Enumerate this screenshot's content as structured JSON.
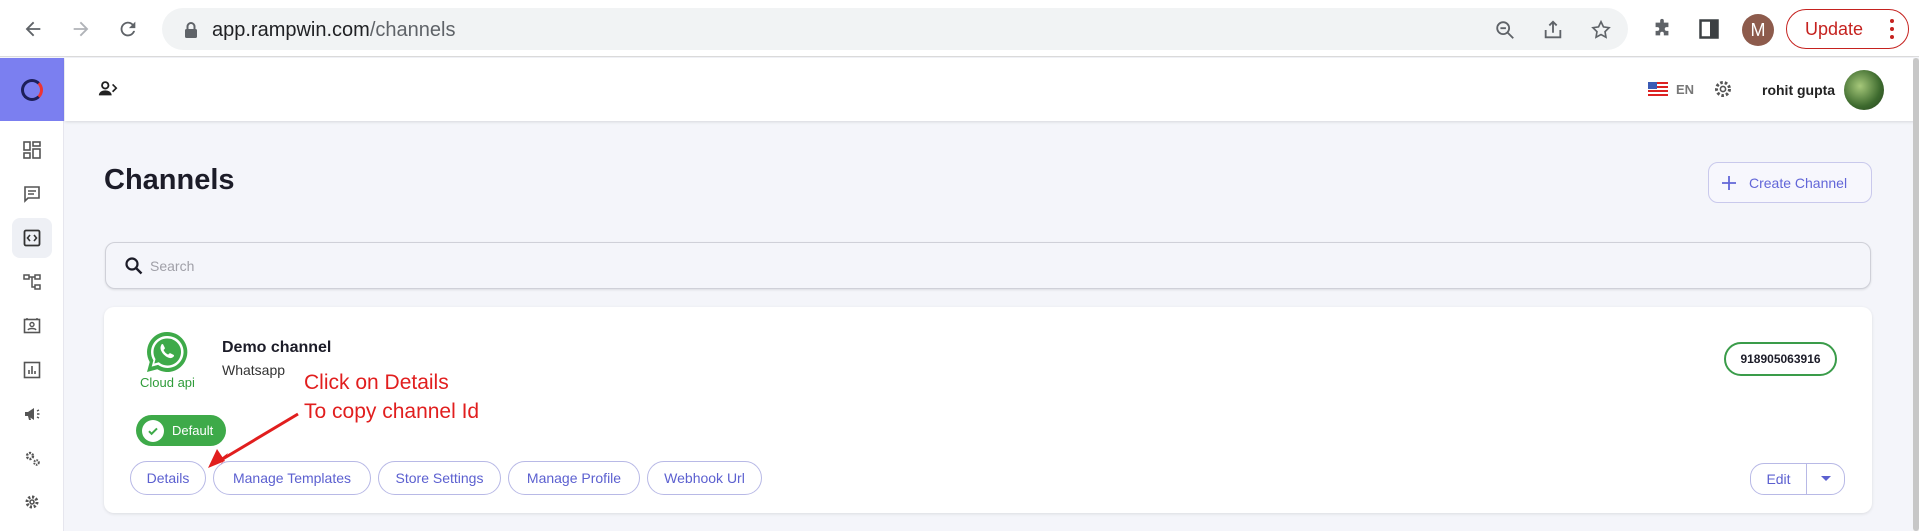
{
  "browser": {
    "url_host": "app.rampwin.com",
    "url_path": "/channels",
    "profile_initial": "M",
    "update_label": "Update"
  },
  "header": {
    "language": "EN",
    "user_name": "rohit gupta"
  },
  "page": {
    "title": "Channels",
    "create_label": "Create Channel",
    "search_placeholder": "Search"
  },
  "channel": {
    "name": "Demo channel",
    "type": "Whatsapp",
    "provider_label": "Cloud api",
    "phone": "918905063916",
    "default_label": "Default",
    "actions": [
      "Details",
      "Manage Templates",
      "Store Settings",
      "Manage Profile",
      "Webhook Url"
    ],
    "edit_label": "Edit"
  },
  "annotation": {
    "line1": "Click on Details",
    "line2": "To copy channel Id",
    "color": "#e11e1e"
  },
  "colors": {
    "accent": "#6266d8",
    "logo_bg": "#7b7ff0",
    "whatsapp_green": "#3eaa49",
    "update_red": "#c5221f"
  }
}
